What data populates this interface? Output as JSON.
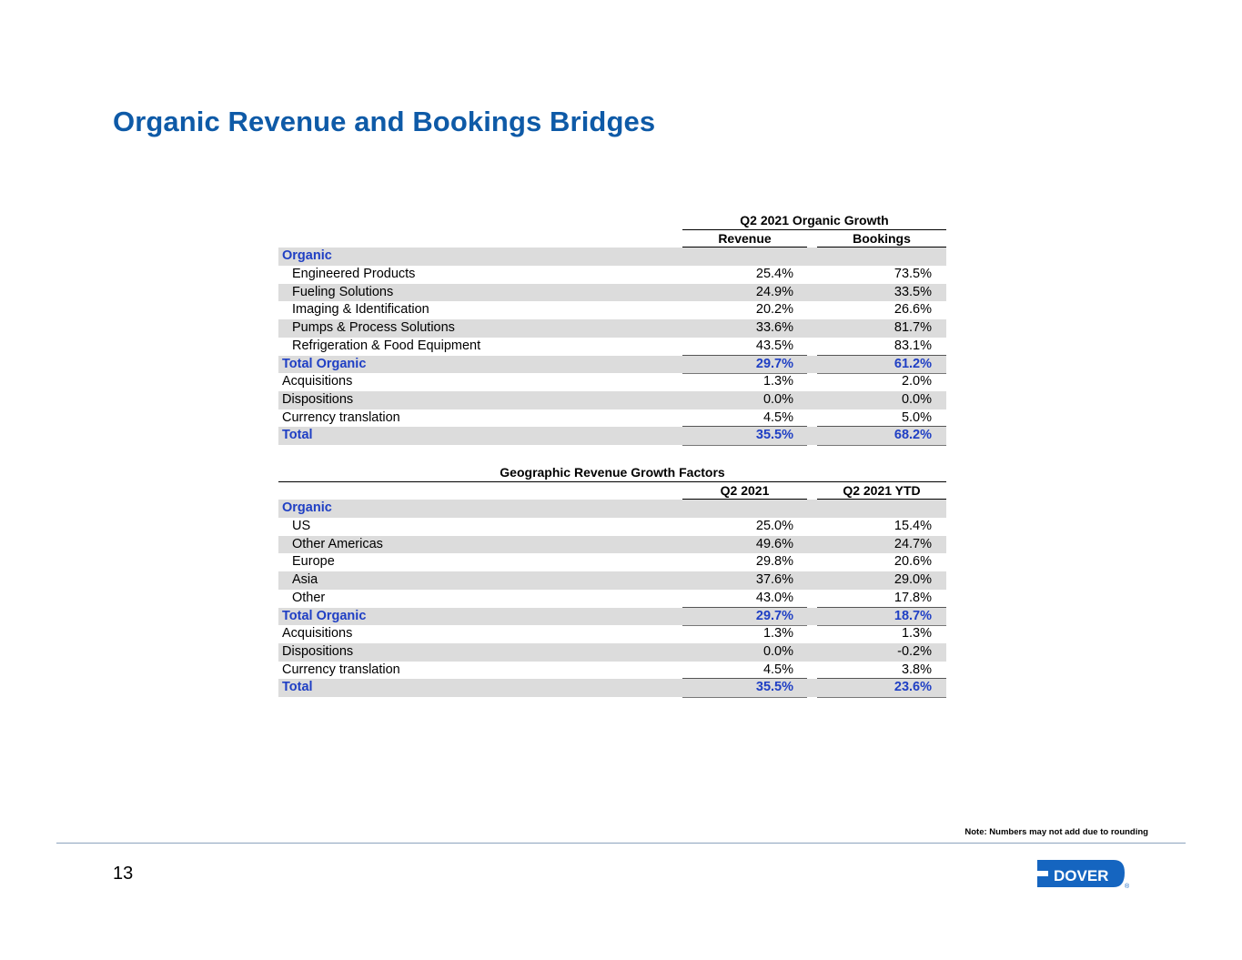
{
  "title": "Organic Revenue and Bookings Bridges",
  "table1": {
    "title": "Q2 2021 Organic Growth",
    "col1": "Revenue",
    "col2": "Bookings",
    "rows": [
      {
        "label": "Organic",
        "v1": "",
        "v2": ""
      },
      {
        "label": "Engineered Products",
        "v1": "25.4%",
        "v2": "73.5%"
      },
      {
        "label": "Fueling Solutions",
        "v1": "24.9%",
        "v2": "33.5%"
      },
      {
        "label": "Imaging & Identification",
        "v1": "20.2%",
        "v2": "26.6%"
      },
      {
        "label": "Pumps & Process Solutions",
        "v1": "33.6%",
        "v2": "81.7%"
      },
      {
        "label": "Refrigeration & Food Equipment",
        "v1": "43.5%",
        "v2": "83.1%"
      },
      {
        "label": "Total Organic",
        "v1": "29.7%",
        "v2": "61.2%"
      },
      {
        "label": "Acquisitions",
        "v1": "1.3%",
        "v2": "2.0%"
      },
      {
        "label": "Dispositions",
        "v1": "0.0%",
        "v2": "0.0%"
      },
      {
        "label": "Currency translation",
        "v1": "4.5%",
        "v2": "5.0%"
      },
      {
        "label": "Total",
        "v1": "35.5%",
        "v2": "68.2%"
      }
    ]
  },
  "table2": {
    "title": "Geographic Revenue Growth Factors",
    "col1": "Q2 2021",
    "col2": "Q2 2021 YTD",
    "rows": [
      {
        "label": "Organic",
        "v1": "",
        "v2": ""
      },
      {
        "label": "US",
        "v1": "25.0%",
        "v2": "15.4%"
      },
      {
        "label": "Other Americas",
        "v1": "49.6%",
        "v2": "24.7%"
      },
      {
        "label": "Europe",
        "v1": "29.8%",
        "v2": "20.6%"
      },
      {
        "label": "Asia",
        "v1": "37.6%",
        "v2": "29.0%"
      },
      {
        "label": "Other",
        "v1": "43.0%",
        "v2": "17.8%"
      },
      {
        "label": "Total Organic",
        "v1": "29.7%",
        "v2": "18.7%"
      },
      {
        "label": "Acquisitions",
        "v1": "1.3%",
        "v2": "1.3%"
      },
      {
        "label": "Dispositions",
        "v1": "0.0%",
        "v2": "-0.2%"
      },
      {
        "label": "Currency translation",
        "v1": "4.5%",
        "v2": "3.8%"
      },
      {
        "label": "Total",
        "v1": "35.5%",
        "v2": "23.6%"
      }
    ]
  },
  "note": "Note: Numbers may not add due to rounding",
  "page_number": "13",
  "logo_text": "DOVER",
  "logo_mark": "®",
  "colors": {
    "title": "#0e5aa7",
    "highlight": "#1f3fc4",
    "shade": "#dcdcdc",
    "logo": "#1565c0"
  }
}
